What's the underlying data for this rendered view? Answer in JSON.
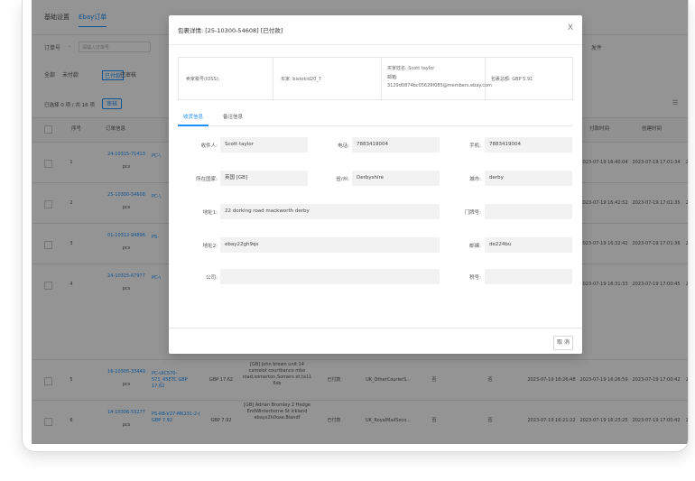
{
  "top_tabs": [
    "基础设置",
    "Ebay订单"
  ],
  "filters": {
    "select_label": "订单号",
    "input_placeholder": "请输入订单号",
    "right_label": "发件"
  },
  "subtabs": [
    "全部",
    "未付款",
    "已付款",
    "已审核"
  ],
  "toolbar": {
    "selected_text": "已选择 0 项 / 共 18 项",
    "audit_button": "审核"
  },
  "table_headers": [
    "序号",
    "订单信息",
    "付款时间",
    "创建时间"
  ],
  "rows": [
    {
      "index": "1",
      "order": "24-10315-71413",
      "unit": "pcs",
      "sku": "PC-\\",
      "amount": "",
      "addr": "",
      "status": "",
      "ship": "",
      "col1": "",
      "col2": "",
      "time1": "",
      "time2": "2023-07-19 16:40:04",
      "time3": "2023-07-19 17:01:34",
      "time4": "2023-"
    },
    {
      "index": "2",
      "order": "25-10300-54608",
      "unit": "pcs",
      "sku": "PC-\\",
      "amount": "",
      "addr": "",
      "status": "",
      "ship": "",
      "col1": "",
      "col2": "",
      "time1": "",
      "time2": "2023-07-19 16:42:52",
      "time3": "2023-07-19 17:01:35",
      "time4": "2023-"
    },
    {
      "index": "3",
      "order": "01-10312-94896",
      "unit": "pcs",
      "sku": "PS-",
      "amount": "",
      "addr": "",
      "status": "",
      "ship": "",
      "col1": "",
      "col2": "",
      "time1": "",
      "time2": "2023-07-19 16:32:42",
      "time3": "2023-07-19 17:01:36",
      "time4": "2023-"
    },
    {
      "index": "4",
      "order": "24-10315-67977",
      "unit": "pcs",
      "sku": "PC-\\",
      "amount": "",
      "addr": "",
      "status": "",
      "ship": "",
      "col1": "",
      "col2": "",
      "time1": "",
      "time2": "2023-07-19 16:31:33",
      "time3": "2023-07-19 17:00:45",
      "time4": "2023-"
    },
    {
      "index": "5",
      "order": "16-10305-33449",
      "unit": "pcs",
      "sku": "PC-UIC570-571_45ETC GBP 17.62",
      "amount": "GBP 17.62",
      "addr": "[GB] john brown unit 14 camelot courtbanco mbe road,somerton,Somers et,ta11 6sb",
      "status": "已付款",
      "ship": "UK_OtherCourierS...",
      "col1": "否",
      "col2": "否",
      "time1": "2023-07-19 16:26:48",
      "time2": "2023-07-19 16:26:59",
      "time3": "2023-07-19 17:00:42",
      "time4": "2023-"
    },
    {
      "index": "6",
      "order": "14-10306-53277",
      "unit": "pcs",
      "sku": "PS-RB-V27-MK231-2-( GBP 7.92",
      "amount": "GBP 7.92",
      "addr": "[GB] Adrian Bromley 2 Hedge EndWinterborne St ickland ebays2h0oxe.Blandf",
      "status": "已付款",
      "ship": "UK_RoyalMailSeco...",
      "col1": "否",
      "col2": "否",
      "time1": "2023-07-19 16:21:22",
      "time2": "2023-07-19 16:23:25",
      "time3": "2023-07-19 17:00:42",
      "time4": "2023-"
    }
  ],
  "modal": {
    "title": "包裹详情: [25-10300-54608] [已付款]",
    "info": {
      "seller_label": "卖家税号(IOSS):",
      "buyer_label": "买家: bistokid20_7",
      "buyer_name": "买家姓名: Scott taylor",
      "buyer_email": "邮箱: 3129d0874bc05629f085@members.ebay.com",
      "total": "包裹总额: GBP 5.91"
    },
    "tabs": [
      "收货信息",
      "备注信息"
    ],
    "fields": {
      "recipient_label": "收件人:",
      "recipient": "Scott taylor",
      "phone_label": "电话:",
      "phone": "7883419004",
      "mobile_label": "手机:",
      "mobile": "7883419004",
      "country_label": "所在国家:",
      "country": "英国 [GB]",
      "state_label": "省/州:",
      "state": "Derbyshire",
      "city_label": "城市:",
      "city": "derby",
      "address1_label": "地址1:",
      "address1": "22 dorking road mackworth derby",
      "door_label": "门牌号:",
      "door": "",
      "address2_label": "地址2:",
      "address2": "ebay22gh9qs",
      "zip_label": "邮编:",
      "zip": "de224bu",
      "company_label": "公司:",
      "company": "",
      "tax_label": "税号:",
      "tax": ""
    },
    "cancel": "取 消",
    "close": "X"
  },
  "colors": {
    "accent": "#1890ff",
    "overlay": "rgba(0,0,0,0.42)"
  }
}
